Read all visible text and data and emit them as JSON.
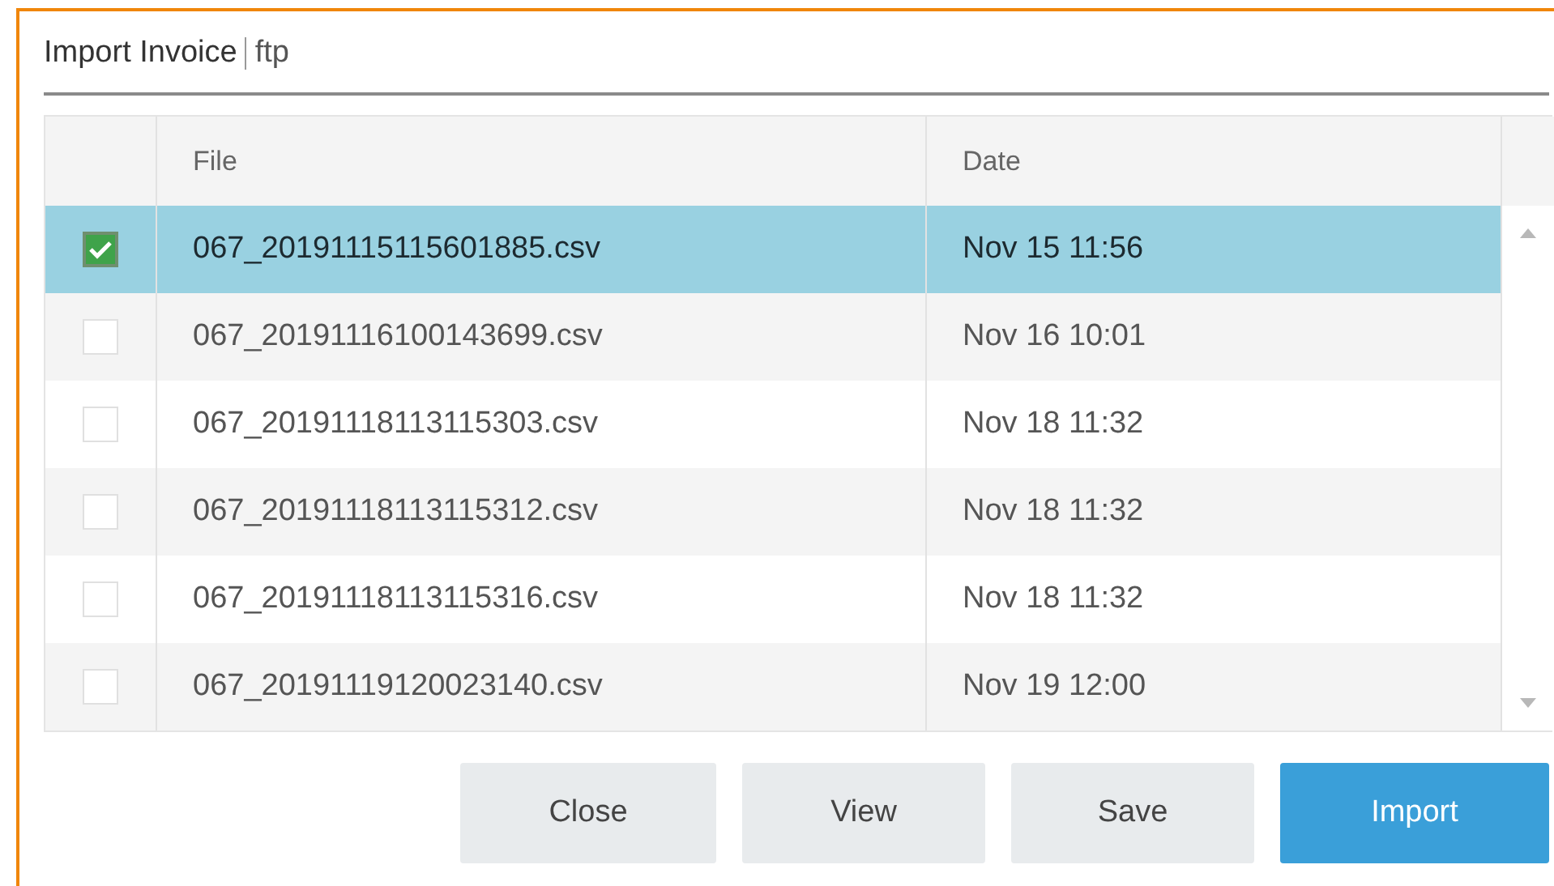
{
  "dialog": {
    "title": "Import Invoice",
    "source": "ftp"
  },
  "table": {
    "columns": [
      "File",
      "Date"
    ],
    "rows": [
      {
        "file": "067_20191115115601885.csv",
        "date": "Nov 15 11:56",
        "checked": true,
        "selected": true
      },
      {
        "file": "067_20191116100143699.csv",
        "date": "Nov 16 10:01",
        "checked": false,
        "selected": false
      },
      {
        "file": "067_20191118113115303.csv",
        "date": "Nov 18 11:32",
        "checked": false,
        "selected": false
      },
      {
        "file": "067_20191118113115312.csv",
        "date": "Nov 18 11:32",
        "checked": false,
        "selected": false
      },
      {
        "file": "067_20191118113115316.csv",
        "date": "Nov 18 11:32",
        "checked": false,
        "selected": false
      },
      {
        "file": "067_20191119120023140.csv",
        "date": "Nov 19 12:00",
        "checked": false,
        "selected": false
      }
    ]
  },
  "buttons": [
    {
      "label": "Close",
      "kind": "default"
    },
    {
      "label": "View",
      "kind": "default"
    },
    {
      "label": "Save",
      "kind": "default"
    },
    {
      "label": "Import",
      "kind": "primary"
    }
  ]
}
